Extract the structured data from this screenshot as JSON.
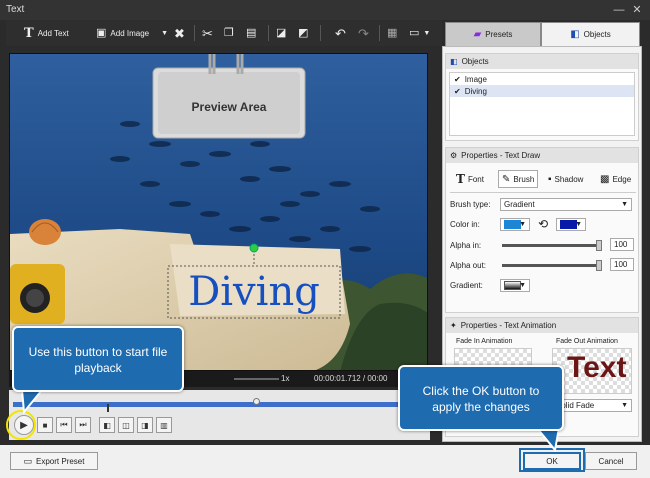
{
  "window": {
    "title": "Text"
  },
  "toolbar": {
    "add_text": "Add Text",
    "add_image": "Add Image"
  },
  "tabs": {
    "presets": "Presets",
    "objects": "Objects"
  },
  "preview": {
    "area_label": "Preview Area",
    "text_object": "Diving"
  },
  "video_bar": {
    "speed": "1x",
    "time": "00:00:01.712 / 00:00"
  },
  "objects_panel": {
    "title": "Objects",
    "items": [
      {
        "label": "Image",
        "checked": true
      },
      {
        "label": "Diving",
        "checked": true
      }
    ]
  },
  "text_draw": {
    "title": "Properties - Text Draw",
    "tabs": {
      "font": "Font",
      "brush": "Brush",
      "shadow": "Shadow",
      "edge": "Edge"
    },
    "brush_type_label": "Brush type:",
    "brush_type_value": "Gradient",
    "color_in_label": "Color in:",
    "color_1": "#1c86d6",
    "color_2": "#0a1aa8",
    "alpha_in_label": "Alpha in:",
    "alpha_in_value": "100",
    "alpha_out_label": "Alpha out:",
    "alpha_out_value": "100",
    "gradient_label": "Gradient:"
  },
  "text_animation": {
    "title": "Properties - Text Animation",
    "fade_in": "Fade In Animation",
    "fade_out": "Fade Out Animation",
    "preview_text": "Text",
    "fade_out_select": "Solid Fade"
  },
  "buttons": {
    "export_preset": "Export Preset",
    "ok": "OK",
    "cancel": "Cancel"
  },
  "callouts": {
    "play": "Use this button to start file playback",
    "ok": "Click the OK button to apply the changes"
  }
}
